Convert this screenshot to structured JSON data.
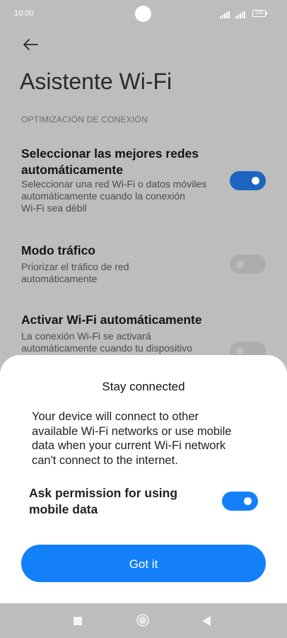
{
  "status_bar": {
    "time": "10:00",
    "battery": "100",
    "icons": [
      "signal-icon",
      "signal-icon",
      "battery-icon"
    ]
  },
  "settings": {
    "back_icon": "back-arrow-icon",
    "title": "Asistente Wi-Fi",
    "section_header": "OPTIMIZACIÓN DE CONEXIÓN",
    "items": [
      {
        "title_lines": [
          "Seleccionar las mejores redes",
          "automáticamente"
        ],
        "desc_lines": [
          "Seleccionar una red Wi-Fi o datos móviles",
          "automáticamente cuando la conexión",
          "Wi-Fi sea débil"
        ],
        "toggle": "on"
      },
      {
        "title_lines": [
          "Modo tráfico"
        ],
        "desc_lines": [
          "Priorizar el tráfico de red",
          "automáticamente"
        ],
        "toggle": "off"
      },
      {
        "title_lines": [
          "Activar Wi-Fi automáticamente"
        ],
        "desc_lines": [
          "La conexión Wi-Fi se activará",
          "automáticamente cuando tu dispositivo"
        ],
        "toggle": "off"
      }
    ]
  },
  "dialog": {
    "title": "Stay connected",
    "body_lines": [
      "Your device will connect to other",
      "available Wi-Fi networks or use mobile",
      "data when your current Wi-Fi network",
      "can't connect to the internet."
    ],
    "permission_label_lines": [
      "Ask permission for using",
      "mobile data"
    ],
    "permission_toggle": "on",
    "button_label": "Got it"
  },
  "nav_bar": {
    "icons": [
      "recents-icon",
      "home-icon",
      "back-icon"
    ]
  },
  "colors": {
    "dim_background": "#bdbdbd",
    "accent": "#1380fa",
    "accent_dimmed": "#1c64c0"
  }
}
